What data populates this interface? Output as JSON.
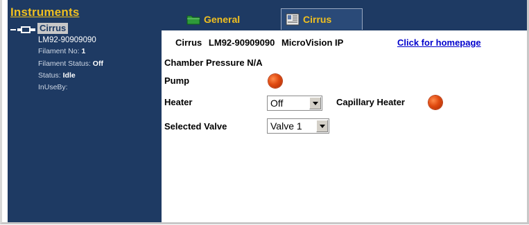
{
  "sidebar": {
    "title": "Instruments",
    "instrument": {
      "name": "Cirrus",
      "serial": "LM92-90909090",
      "filament_no_label": "Filament No:",
      "filament_no_value": "1",
      "filament_status_label": "Filament Status:",
      "filament_status_value": "Off",
      "status_label": "Status:",
      "status_value": "Idle",
      "inuseby_label": "InUseBy:",
      "inuseby_value": ""
    }
  },
  "tabs": [
    {
      "label": "General",
      "icon": "folder-icon"
    },
    {
      "label": "Cirrus",
      "icon": "instrument-icon"
    }
  ],
  "header": {
    "name": "Cirrus",
    "serial": "LM92-90909090",
    "product": "MicroVision IP",
    "homepage_link": "Click for homepage"
  },
  "controls": {
    "chamber_pressure_label": "Chamber Pressure",
    "chamber_pressure_value": "N/A",
    "pump_label": "Pump",
    "heater_label": "Heater",
    "heater_value": "Off",
    "capillary_heater_label": "Capillary Heater",
    "selected_valve_label": "Selected Valve",
    "selected_valve_value": "Valve 1"
  },
  "colors": {
    "sidebar_bg": "#1e3a63",
    "accent_yellow": "#f0c020",
    "led_red": "#e04a10",
    "link_blue": "#0000cc"
  }
}
